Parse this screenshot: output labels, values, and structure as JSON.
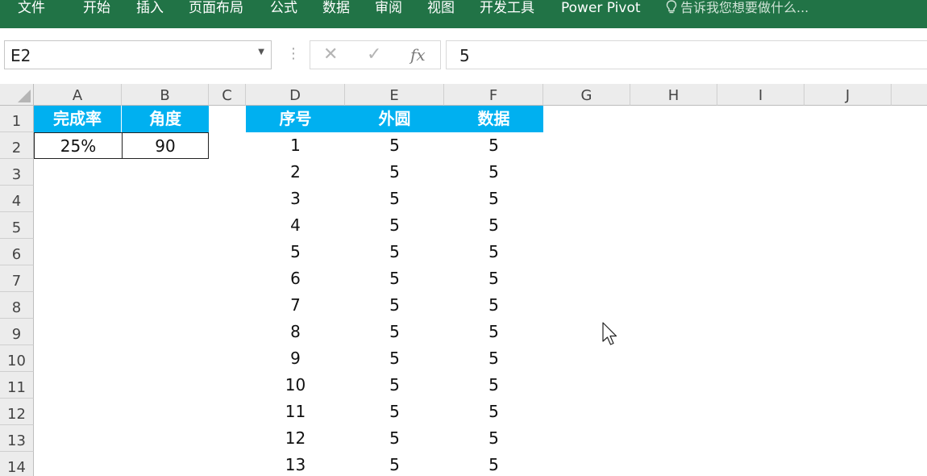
{
  "ribbon": {
    "tabs": [
      "文件",
      "开始",
      "插入",
      "页面布局",
      "公式",
      "数据",
      "审阅",
      "视图",
      "开发工具",
      "Power Pivot"
    ],
    "tell_me": "告诉我您想要做什么..."
  },
  "formula_bar": {
    "name_box": "E2",
    "cancel": "✕",
    "enter": "✓",
    "fx": "fx",
    "value": "5"
  },
  "columns": [
    "A",
    "B",
    "C",
    "D",
    "E",
    "F",
    "G",
    "H",
    "I",
    "J"
  ],
  "rows": [
    "1",
    "2",
    "3",
    "4",
    "5",
    "6",
    "7",
    "8",
    "9",
    "10",
    "11",
    "12",
    "13",
    "14"
  ],
  "table1": {
    "headers": [
      "完成率",
      "角度"
    ],
    "values": [
      "25%",
      "90"
    ]
  },
  "table2": {
    "headers": [
      "序号",
      "外圆",
      "数据"
    ],
    "rows": [
      [
        "1",
        "5",
        "5"
      ],
      [
        "2",
        "5",
        "5"
      ],
      [
        "3",
        "5",
        "5"
      ],
      [
        "4",
        "5",
        "5"
      ],
      [
        "5",
        "5",
        "5"
      ],
      [
        "6",
        "5",
        "5"
      ],
      [
        "7",
        "5",
        "5"
      ],
      [
        "8",
        "5",
        "5"
      ],
      [
        "9",
        "5",
        "5"
      ],
      [
        "10",
        "5",
        "5"
      ],
      [
        "11",
        "5",
        "5"
      ],
      [
        "12",
        "5",
        "5"
      ],
      [
        "13",
        "5",
        "5"
      ]
    ]
  },
  "colors": {
    "ribbon": "#217346",
    "header_fill": "#00b0f0"
  }
}
